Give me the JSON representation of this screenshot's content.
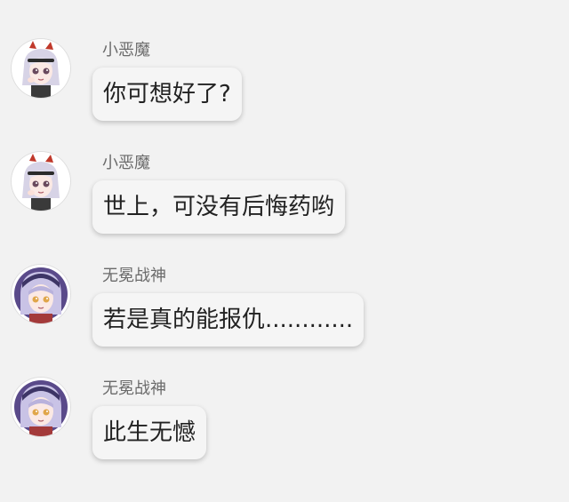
{
  "messages": [
    {
      "sender": "小恶魔",
      "text": "你可想好了?",
      "avatar_icon": "devil-girl-avatar-icon"
    },
    {
      "sender": "小恶魔",
      "text": "世上，可没有后悔药哟",
      "avatar_icon": "devil-girl-avatar-icon"
    },
    {
      "sender": "无冕战神",
      "text": "若是真的能报仇............",
      "avatar_icon": "war-god-avatar-icon"
    },
    {
      "sender": "无冕战神",
      "text": "此生无憾",
      "avatar_icon": "war-god-avatar-icon"
    }
  ],
  "colors": {
    "background": "#f2f2f2",
    "bubble": "#f5f5f5",
    "sender_text": "#6b6b6b",
    "message_text": "#222222"
  }
}
